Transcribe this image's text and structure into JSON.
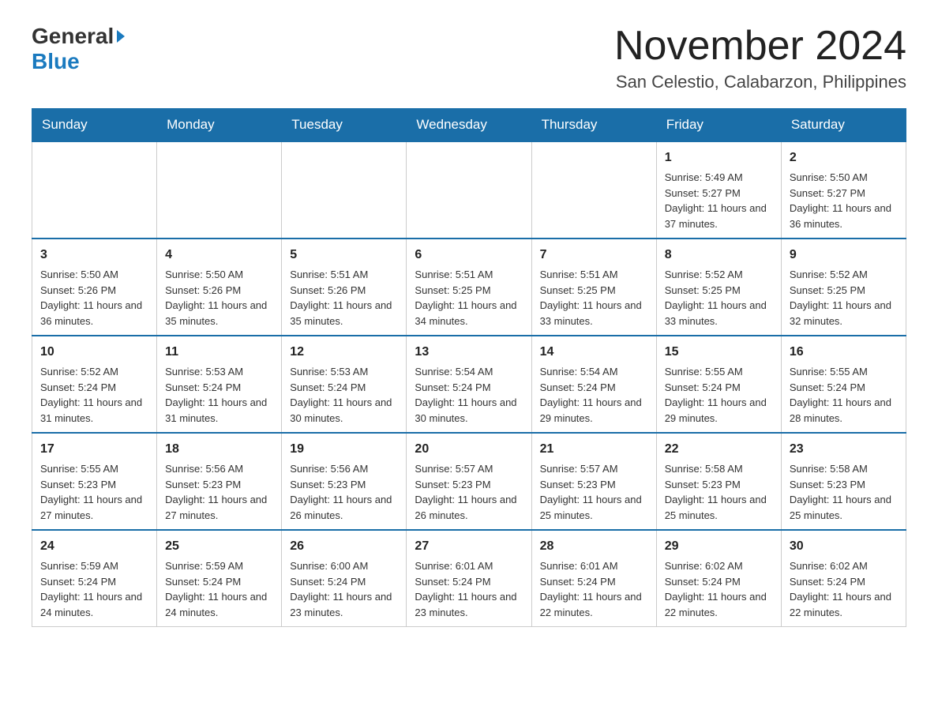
{
  "logo": {
    "general": "General",
    "blue": "Blue"
  },
  "header": {
    "month_title": "November 2024",
    "location": "San Celestio, Calabarzon, Philippines"
  },
  "days_of_week": [
    "Sunday",
    "Monday",
    "Tuesday",
    "Wednesday",
    "Thursday",
    "Friday",
    "Saturday"
  ],
  "weeks": [
    [
      {
        "day": "",
        "info": ""
      },
      {
        "day": "",
        "info": ""
      },
      {
        "day": "",
        "info": ""
      },
      {
        "day": "",
        "info": ""
      },
      {
        "day": "",
        "info": ""
      },
      {
        "day": "1",
        "info": "Sunrise: 5:49 AM\nSunset: 5:27 PM\nDaylight: 11 hours and 37 minutes."
      },
      {
        "day": "2",
        "info": "Sunrise: 5:50 AM\nSunset: 5:27 PM\nDaylight: 11 hours and 36 minutes."
      }
    ],
    [
      {
        "day": "3",
        "info": "Sunrise: 5:50 AM\nSunset: 5:26 PM\nDaylight: 11 hours and 36 minutes."
      },
      {
        "day": "4",
        "info": "Sunrise: 5:50 AM\nSunset: 5:26 PM\nDaylight: 11 hours and 35 minutes."
      },
      {
        "day": "5",
        "info": "Sunrise: 5:51 AM\nSunset: 5:26 PM\nDaylight: 11 hours and 35 minutes."
      },
      {
        "day": "6",
        "info": "Sunrise: 5:51 AM\nSunset: 5:25 PM\nDaylight: 11 hours and 34 minutes."
      },
      {
        "day": "7",
        "info": "Sunrise: 5:51 AM\nSunset: 5:25 PM\nDaylight: 11 hours and 33 minutes."
      },
      {
        "day": "8",
        "info": "Sunrise: 5:52 AM\nSunset: 5:25 PM\nDaylight: 11 hours and 33 minutes."
      },
      {
        "day": "9",
        "info": "Sunrise: 5:52 AM\nSunset: 5:25 PM\nDaylight: 11 hours and 32 minutes."
      }
    ],
    [
      {
        "day": "10",
        "info": "Sunrise: 5:52 AM\nSunset: 5:24 PM\nDaylight: 11 hours and 31 minutes."
      },
      {
        "day": "11",
        "info": "Sunrise: 5:53 AM\nSunset: 5:24 PM\nDaylight: 11 hours and 31 minutes."
      },
      {
        "day": "12",
        "info": "Sunrise: 5:53 AM\nSunset: 5:24 PM\nDaylight: 11 hours and 30 minutes."
      },
      {
        "day": "13",
        "info": "Sunrise: 5:54 AM\nSunset: 5:24 PM\nDaylight: 11 hours and 30 minutes."
      },
      {
        "day": "14",
        "info": "Sunrise: 5:54 AM\nSunset: 5:24 PM\nDaylight: 11 hours and 29 minutes."
      },
      {
        "day": "15",
        "info": "Sunrise: 5:55 AM\nSunset: 5:24 PM\nDaylight: 11 hours and 29 minutes."
      },
      {
        "day": "16",
        "info": "Sunrise: 5:55 AM\nSunset: 5:24 PM\nDaylight: 11 hours and 28 minutes."
      }
    ],
    [
      {
        "day": "17",
        "info": "Sunrise: 5:55 AM\nSunset: 5:23 PM\nDaylight: 11 hours and 27 minutes."
      },
      {
        "day": "18",
        "info": "Sunrise: 5:56 AM\nSunset: 5:23 PM\nDaylight: 11 hours and 27 minutes."
      },
      {
        "day": "19",
        "info": "Sunrise: 5:56 AM\nSunset: 5:23 PM\nDaylight: 11 hours and 26 minutes."
      },
      {
        "day": "20",
        "info": "Sunrise: 5:57 AM\nSunset: 5:23 PM\nDaylight: 11 hours and 26 minutes."
      },
      {
        "day": "21",
        "info": "Sunrise: 5:57 AM\nSunset: 5:23 PM\nDaylight: 11 hours and 25 minutes."
      },
      {
        "day": "22",
        "info": "Sunrise: 5:58 AM\nSunset: 5:23 PM\nDaylight: 11 hours and 25 minutes."
      },
      {
        "day": "23",
        "info": "Sunrise: 5:58 AM\nSunset: 5:23 PM\nDaylight: 11 hours and 25 minutes."
      }
    ],
    [
      {
        "day": "24",
        "info": "Sunrise: 5:59 AM\nSunset: 5:24 PM\nDaylight: 11 hours and 24 minutes."
      },
      {
        "day": "25",
        "info": "Sunrise: 5:59 AM\nSunset: 5:24 PM\nDaylight: 11 hours and 24 minutes."
      },
      {
        "day": "26",
        "info": "Sunrise: 6:00 AM\nSunset: 5:24 PM\nDaylight: 11 hours and 23 minutes."
      },
      {
        "day": "27",
        "info": "Sunrise: 6:01 AM\nSunset: 5:24 PM\nDaylight: 11 hours and 23 minutes."
      },
      {
        "day": "28",
        "info": "Sunrise: 6:01 AM\nSunset: 5:24 PM\nDaylight: 11 hours and 22 minutes."
      },
      {
        "day": "29",
        "info": "Sunrise: 6:02 AM\nSunset: 5:24 PM\nDaylight: 11 hours and 22 minutes."
      },
      {
        "day": "30",
        "info": "Sunrise: 6:02 AM\nSunset: 5:24 PM\nDaylight: 11 hours and 22 minutes."
      }
    ]
  ]
}
